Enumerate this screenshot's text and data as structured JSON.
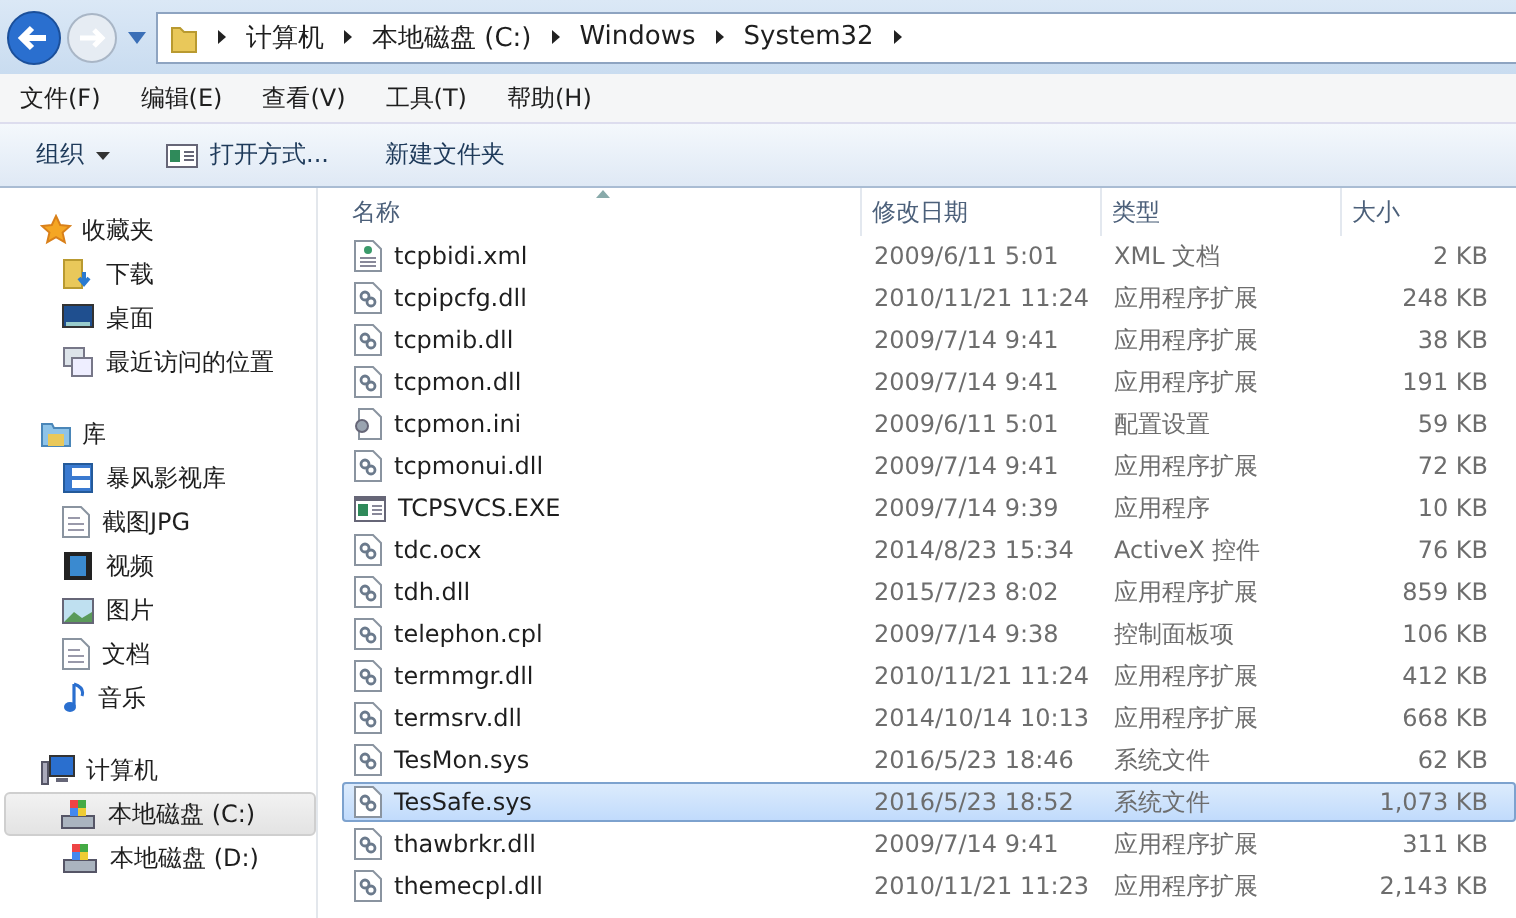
{
  "address_bar": {
    "crumbs": [
      "计算机",
      "本地磁盘 (C:)",
      "Windows",
      "System32"
    ]
  },
  "menu_bar": [
    "文件(F)",
    "编辑(E)",
    "查看(V)",
    "工具(T)",
    "帮助(H)"
  ],
  "toolbar": [
    {
      "kind": "dropdown",
      "label": "组织"
    },
    {
      "kind": "open",
      "label": "打开方式..."
    },
    {
      "kind": "plain",
      "label": "新建文件夹"
    }
  ],
  "sidebar": [
    {
      "label": "收藏夹",
      "kind": "star",
      "children": [
        {
          "label": "下载",
          "kind": "download",
          "selected": false
        },
        {
          "label": "桌面",
          "kind": "desktop",
          "selected": false
        },
        {
          "label": "最近访问的位置",
          "kind": "recent",
          "selected": false
        }
      ]
    },
    {
      "label": "库",
      "kind": "library",
      "children": [
        {
          "label": "暴风影视库",
          "kind": "media",
          "selected": false
        },
        {
          "label": "截图JPG",
          "kind": "doc",
          "selected": false
        },
        {
          "label": "视频",
          "kind": "video",
          "selected": false
        },
        {
          "label": "图片",
          "kind": "picture",
          "selected": false
        },
        {
          "label": "文档",
          "kind": "doc",
          "selected": false
        },
        {
          "label": "音乐",
          "kind": "music",
          "selected": false
        }
      ]
    },
    {
      "label": "计算机",
      "kind": "computer",
      "children": [
        {
          "label": "本地磁盘 (C:)",
          "kind": "drive",
          "selected": true
        },
        {
          "label": "本地磁盘 (D:)",
          "kind": "drive",
          "selected": false
        }
      ]
    }
  ],
  "table": {
    "columns": [
      "名称",
      "修改日期",
      "类型",
      "大小"
    ],
    "rows": [
      {
        "name": "tcpbidi.xml",
        "kind": "xml",
        "date": "2009/6/11 5:01",
        "type": "XML 文档",
        "size": "2 KB",
        "selected": false
      },
      {
        "name": "tcpipcfg.dll",
        "kind": "dll",
        "date": "2010/11/21 11:24",
        "type": "应用程序扩展",
        "size": "248 KB",
        "selected": false
      },
      {
        "name": "tcpmib.dll",
        "kind": "dll",
        "date": "2009/7/14 9:41",
        "type": "应用程序扩展",
        "size": "38 KB",
        "selected": false
      },
      {
        "name": "tcpmon.dll",
        "kind": "dll",
        "date": "2009/7/14 9:41",
        "type": "应用程序扩展",
        "size": "191 KB",
        "selected": false
      },
      {
        "name": "tcpmon.ini",
        "kind": "ini",
        "date": "2009/6/11 5:01",
        "type": "配置设置",
        "size": "59 KB",
        "selected": false
      },
      {
        "name": "tcpmonui.dll",
        "kind": "dll",
        "date": "2009/7/14 9:41",
        "type": "应用程序扩展",
        "size": "72 KB",
        "selected": false
      },
      {
        "name": "TCPSVCS.EXE",
        "kind": "exe",
        "date": "2009/7/14 9:39",
        "type": "应用程序",
        "size": "10 KB",
        "selected": false
      },
      {
        "name": "tdc.ocx",
        "kind": "dll",
        "date": "2014/8/23 15:34",
        "type": "ActiveX 控件",
        "size": "76 KB",
        "selected": false
      },
      {
        "name": "tdh.dll",
        "kind": "dll",
        "date": "2015/7/23 8:02",
        "type": "应用程序扩展",
        "size": "859 KB",
        "selected": false
      },
      {
        "name": "telephon.cpl",
        "kind": "dll",
        "date": "2009/7/14 9:38",
        "type": "控制面板项",
        "size": "106 KB",
        "selected": false
      },
      {
        "name": "termmgr.dll",
        "kind": "dll",
        "date": "2010/11/21 11:24",
        "type": "应用程序扩展",
        "size": "412 KB",
        "selected": false
      },
      {
        "name": "termsrv.dll",
        "kind": "dll",
        "date": "2014/10/14 10:13",
        "type": "应用程序扩展",
        "size": "668 KB",
        "selected": false
      },
      {
        "name": "TesMon.sys",
        "kind": "dll",
        "date": "2016/5/23 18:46",
        "type": "系统文件",
        "size": "62 KB",
        "selected": false
      },
      {
        "name": "TesSafe.sys",
        "kind": "dll",
        "date": "2016/5/23 18:52",
        "type": "系统文件",
        "size": "1,073 KB",
        "selected": true
      },
      {
        "name": "thawbrkr.dll",
        "kind": "dll",
        "date": "2009/7/14 9:41",
        "type": "应用程序扩展",
        "size": "311 KB",
        "selected": false
      },
      {
        "name": "themecpl.dll",
        "kind": "dll",
        "date": "2010/11/21 11:23",
        "type": "应用程序扩展",
        "size": "2,143 KB",
        "selected": false
      }
    ]
  }
}
